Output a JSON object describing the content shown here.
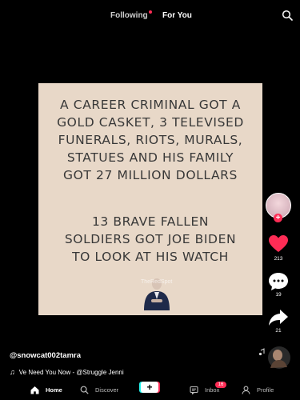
{
  "header": {
    "tabs": [
      {
        "label": "Following",
        "has_dot": true
      },
      {
        "label": "For You",
        "active": true
      }
    ]
  },
  "video": {
    "text_top_lines": [
      "A CAREER CRIMINAL GOT A",
      "GOLD CASKET, 3 TELEVISED",
      "FUNERALS, RIOTS, MURALS,",
      "STATUES AND HIS FAMILY",
      "GOT 27 MILLION DOLLARS"
    ],
    "text_bottom_lines": [
      "13 BRAVE FALLEN",
      "SOLDIERS GOT JOE BIDEN",
      "TO LOOK AT HIS WATCH"
    ],
    "watermark": "TheRedSpot",
    "card_color": "#e8d8c8"
  },
  "actions": {
    "likes": "213",
    "comments": "19",
    "shares": "21"
  },
  "caption": {
    "username": "@snowcat002tamra",
    "sound": "Ve Need You Now - @Struggle Jenni"
  },
  "bottom_nav": {
    "home": "Home",
    "discover": "Discover",
    "create": "+",
    "inbox": "Inbox",
    "inbox_badge": "16",
    "profile": "Profile"
  },
  "colors": {
    "accent": "#fe2c55",
    "background": "#000000"
  }
}
